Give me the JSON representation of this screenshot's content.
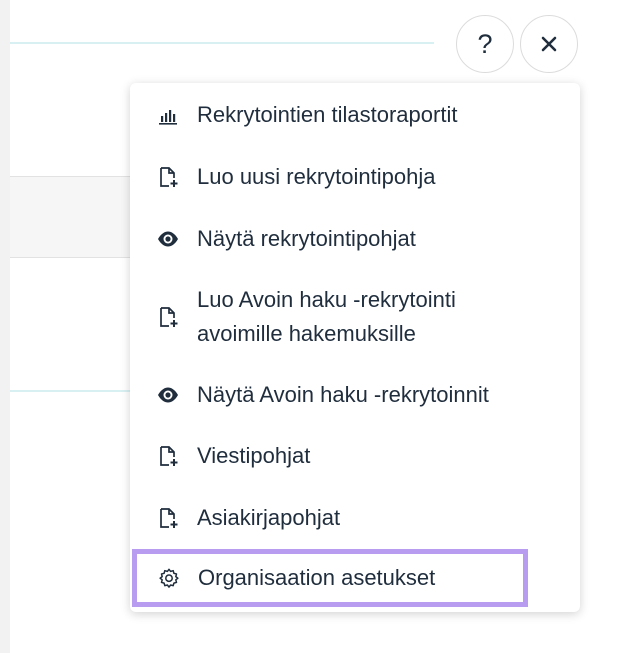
{
  "header": {
    "help_label": "?",
    "close_icon": "close-icon"
  },
  "menu": {
    "items": [
      {
        "label": "Rekrytointien tilastoraportit",
        "icon": "bar-chart-icon"
      },
      {
        "label": "Luo uusi rekrytointipohja",
        "icon": "new-document-icon"
      },
      {
        "label": "Näytä rekrytointipohjat",
        "icon": "eye-icon"
      },
      {
        "label": "Luo Avoin haku -rekrytointi avoimille hakemuksille",
        "line1": "Luo Avoin haku -rekrytointi",
        "line2": "avoimille hakemuksille",
        "icon": "new-document-icon"
      },
      {
        "label": "Näytä Avoin haku -rekrytoinnit",
        "icon": "eye-icon"
      },
      {
        "label": "Viestipohjat",
        "icon": "new-document-icon"
      },
      {
        "label": "Asiakirjapohjat",
        "icon": "new-document-icon"
      },
      {
        "label": "Organisaation asetukset",
        "icon": "gear-icon"
      }
    ],
    "selected_index": 7
  },
  "colors": {
    "text": "#1f2d3d",
    "highlight": "#b89cf0",
    "accent_line": "#d9f0f3"
  }
}
